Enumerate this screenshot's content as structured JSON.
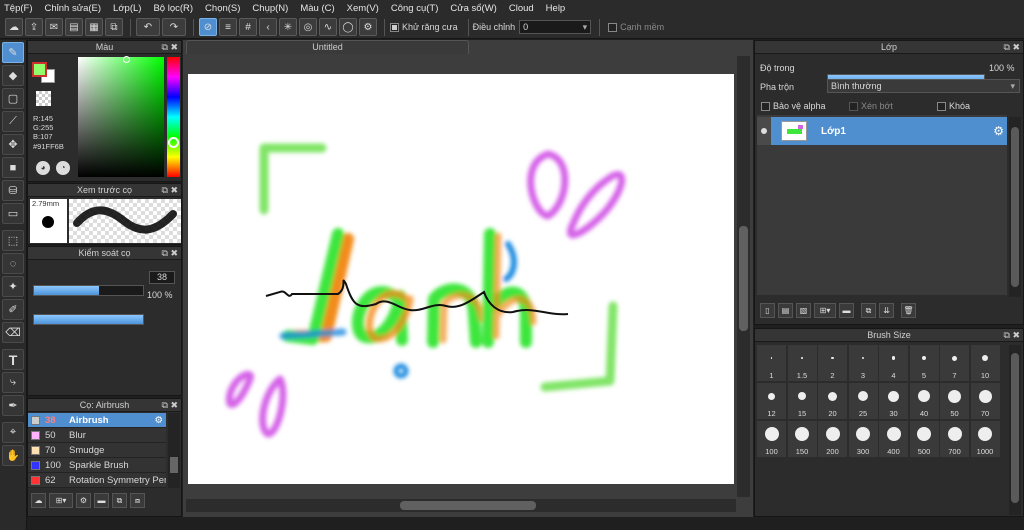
{
  "menu": [
    "Tệp(F)",
    "Chỉnh sửa(E)",
    "Lớp(L)",
    "Bộ lọc(R)",
    "Chọn(S)",
    "Chụp(N)",
    "Màu (C)",
    "Xem(V)",
    "Công cụ(T)",
    "Cửa sổ(W)",
    "Cloud",
    "Help"
  ],
  "toolbar": {
    "antialias_label": "Khử răng cưa",
    "adjust_label": "Điều chỉnh",
    "adjust_value": "0",
    "smooth_label": "Cạnh mềm"
  },
  "color_panel": {
    "title": "Màu",
    "r": "R:145",
    "g": "G:255",
    "b": "B:107",
    "hex": "#91FF6B",
    "foreground": "#91FF6B",
    "hue_color": "#00ff00"
  },
  "brush_preview": {
    "title": "Xem trước cọ",
    "size": "2.79mm"
  },
  "brush_control": {
    "title": "Kiểm soát cọ",
    "size_value": "38",
    "size_fraction": 0.6,
    "opacity_value": "100 %",
    "opacity_fraction": 1.0
  },
  "brush_list": {
    "title": "Cọ: Airbrush",
    "items": [
      {
        "size": "38",
        "name": "Airbrush",
        "color": "#cccccc",
        "selected": true
      },
      {
        "size": "50",
        "name": "Blur",
        "color": "#ffb3ff"
      },
      {
        "size": "70",
        "name": "Smudge",
        "color": "#ffe0b0"
      },
      {
        "size": "100",
        "name": "Sparkle Brush",
        "color": "#3333ff"
      },
      {
        "size": "62",
        "name": "Rotation Symmetry Pen",
        "color": "#ff3333"
      }
    ]
  },
  "canvas": {
    "tab": "Untitled",
    "text": "Lanh",
    "signature": "Lanh"
  },
  "layer_panel": {
    "title": "Lớp",
    "opacity_label": "Độ trong",
    "opacity_value": "100 %",
    "opacity_fraction": 1.0,
    "blend_label": "Pha trộn",
    "blend_value": "Bình thường",
    "protect_alpha": "Bảo vệ alpha",
    "clipping": "Xén bớt",
    "lock": "Khóa",
    "layer_name": "Lớp1"
  },
  "brush_size": {
    "title": "Brush Size",
    "sizes": [
      "1",
      "1.5",
      "2",
      "3",
      "4",
      "5",
      "7",
      "10",
      "12",
      "15",
      "20",
      "25",
      "30",
      "40",
      "50",
      "70",
      "100",
      "150",
      "200",
      "300",
      "400",
      "500",
      "700",
      "1000"
    ]
  }
}
